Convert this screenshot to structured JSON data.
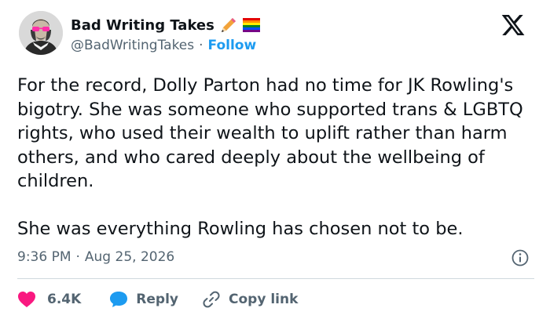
{
  "author": {
    "display_name": "Bad Writing Takes",
    "handle": "@BadWritingTakes",
    "separator": "·",
    "follow_label": "Follow",
    "emojis": [
      "pen-icon",
      "rainbow-flag-icon"
    ]
  },
  "tweet": {
    "text": "For the record, Dolly Parton had no time for JK Rowling's bigotry. She was someone who supported trans & LGBTQ rights, who used their wealth to uplift rather than harm others, and who cared deeply about the wellbeing of children.\n\nShe was everything Rowling has chosen not to be.",
    "time": "9:36 PM",
    "meta_separator": "·",
    "date": "Aug 25, 2026"
  },
  "actions": {
    "likes": "6.4K",
    "reply_label": "Reply",
    "copy_link_label": "Copy link"
  },
  "colors": {
    "accent": "#1d9bf0",
    "like": "#f91880",
    "text": "#0f1419",
    "secondary": "#536471",
    "divider": "#cfd9de"
  }
}
